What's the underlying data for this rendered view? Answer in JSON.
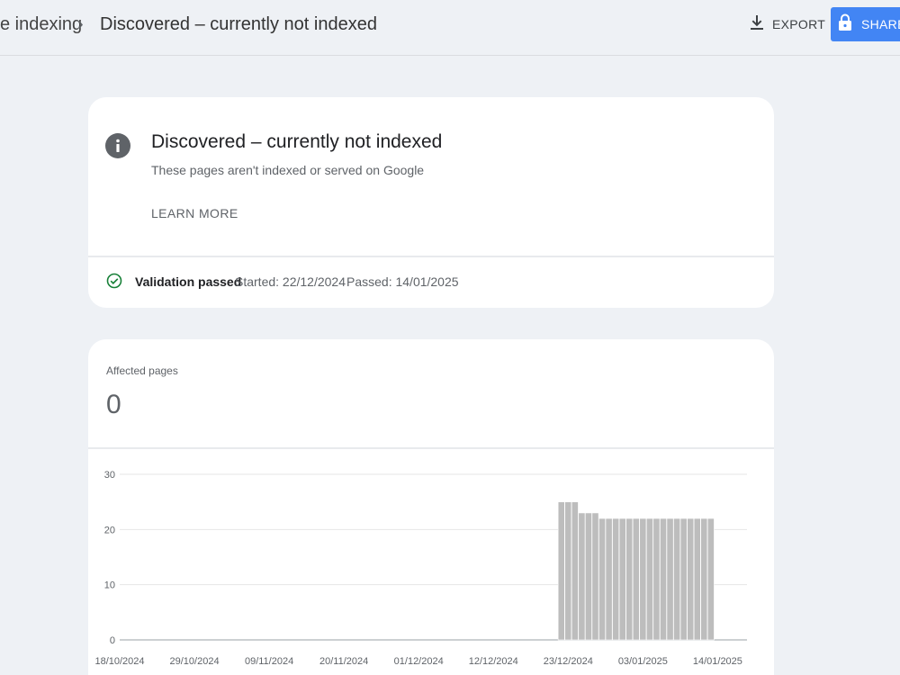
{
  "breadcrumb": {
    "parent": "e indexing",
    "separator": "›",
    "current": "Discovered – currently not indexed"
  },
  "toolbar": {
    "export_label": "EXPORT",
    "share_label": "SHARE",
    "share_color": "#4285f4"
  },
  "issue": {
    "title": "Discovered – currently not indexed",
    "subtitle": "These pages aren't indexed or served on Google",
    "learn_more": "LEARN MORE"
  },
  "validation": {
    "status": "Validation passed",
    "started": "Started: 22/12/2024",
    "passed": "Passed: 14/01/2025",
    "status_color": "#188038"
  },
  "summary": {
    "label": "Affected pages",
    "value": "0"
  },
  "chart_data": {
    "type": "bar",
    "title": "",
    "xlabel": "",
    "ylabel": "",
    "ylim": [
      0,
      30
    ],
    "yticks": [
      0,
      10,
      20,
      30
    ],
    "xtick_labels": [
      "18/10/2024",
      "29/10/2024",
      "09/11/2024",
      "20/11/2024",
      "01/12/2024",
      "12/12/2024",
      "23/12/2024",
      "03/01/2025",
      "14/01/2025"
    ],
    "grid": true,
    "bar_color": "#bdbdbd",
    "categories": [
      "22/12/2024",
      "23/12/2024",
      "24/12/2024",
      "25/12/2024",
      "26/12/2024",
      "27/12/2024",
      "28/12/2024",
      "29/12/2024",
      "30/12/2024",
      "31/12/2024",
      "01/01/2025",
      "02/01/2025",
      "03/01/2025",
      "04/01/2025",
      "05/01/2025",
      "06/01/2025",
      "07/01/2025",
      "08/01/2025",
      "09/01/2025",
      "10/01/2025",
      "11/01/2025",
      "12/01/2025",
      "13/01/2025"
    ],
    "values": [
      25,
      25,
      25,
      23,
      23,
      23,
      22,
      22,
      22,
      22,
      22,
      22,
      22,
      22,
      22,
      22,
      22,
      22,
      22,
      22,
      22,
      22,
      22
    ]
  }
}
